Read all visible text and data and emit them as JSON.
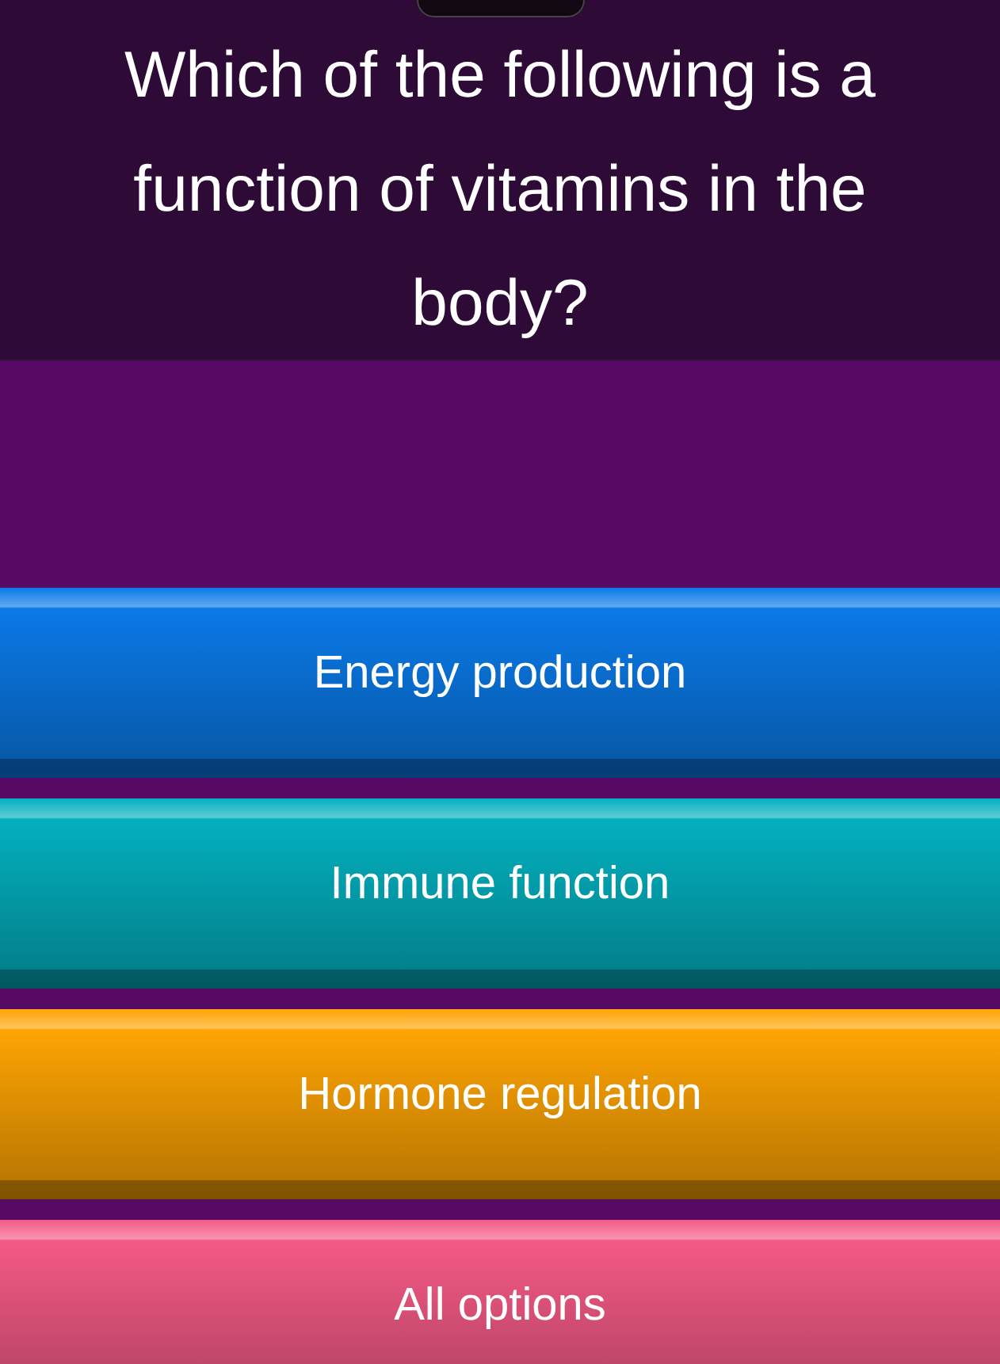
{
  "question": "Which of the following is a function of vitamins in the body?",
  "options": [
    {
      "label": "Energy production",
      "color": "#0a7ae8"
    },
    {
      "label": "Immune function",
      "color": "#03b0bf"
    },
    {
      "label": "Hormone regulation",
      "color": "#ffa403"
    },
    {
      "label": "All options",
      "color": "#f55a86"
    }
  ]
}
